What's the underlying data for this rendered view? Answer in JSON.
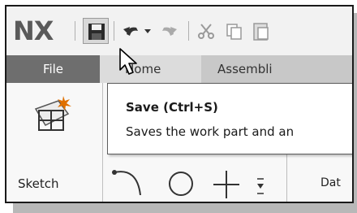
{
  "app": {
    "logo": "NX"
  },
  "quick_access": {
    "buttons": [
      {
        "name": "save",
        "icon": "save-icon",
        "state": "hover"
      },
      {
        "name": "undo",
        "icon": "undo-icon"
      },
      {
        "name": "undo-dropdown",
        "icon": "chevron-down-icon"
      },
      {
        "name": "redo",
        "icon": "redo-icon"
      },
      {
        "name": "cut",
        "icon": "scissors-icon"
      },
      {
        "name": "copy",
        "icon": "copy-icon"
      },
      {
        "name": "paste",
        "icon": "paste-icon"
      }
    ]
  },
  "ribbon": {
    "tabs": [
      {
        "label": "File"
      },
      {
        "label": "Home"
      },
      {
        "label": "Assembli"
      }
    ],
    "sketch_label": "Sketch",
    "datum_label": "Dat"
  },
  "tooltip": {
    "title": "Save (Ctrl+S)",
    "description": "Saves the work part and an"
  },
  "colors": {
    "file_tab_bg": "#6e6e6e",
    "toolbar_bg": "#f2f2f2",
    "sketch_accent": "#e07000"
  }
}
